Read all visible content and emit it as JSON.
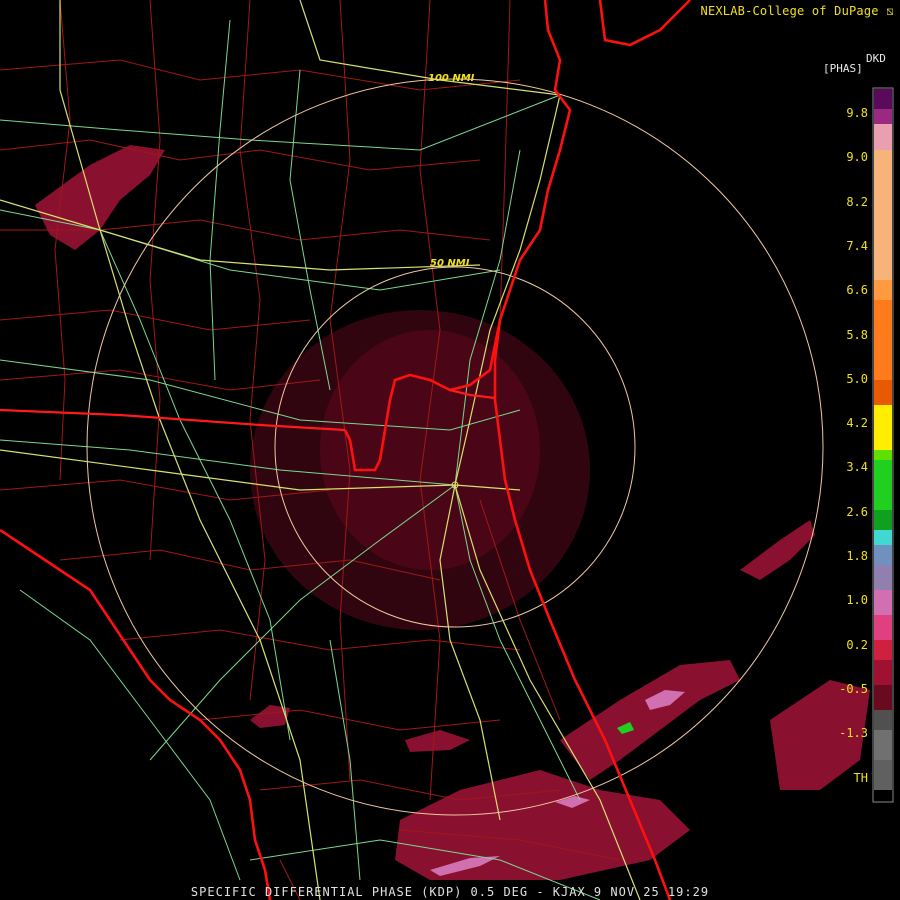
{
  "credit": "NEXLAB-College of DuPage",
  "credit_mark": "⧅",
  "product": {
    "code": "DKD",
    "unit": "[PHAS]",
    "caption": "SPECIFIC DIFFERENTIAL PHASE (KDP) 0.5 DEG - KJAX 9 NOV 25 19:29"
  },
  "range_rings": [
    {
      "label": "100 NMI"
    },
    {
      "label": "50 NMI"
    }
  ],
  "legend": {
    "ticks": [
      "9.8",
      "9.0",
      "8.2",
      "7.4",
      "6.6",
      "5.8",
      "5.0",
      "4.2",
      "3.4",
      "2.6",
      "1.8",
      "1.0",
      "0.2",
      "-0.5",
      "-1.3",
      "TH"
    ],
    "colors": {
      "magenta_top": "#5a0a5a",
      "purple": "#9a2a80",
      "pink_light": "#e8a0b0",
      "peach": "#f7b47a",
      "orange": "#ff7a1a",
      "orange_dark": "#e85a00",
      "yellow": "#ffee00",
      "green": "#20d020",
      "cyan": "#40d8d0",
      "blue_grey": "#7090c0",
      "pink": "#d070b0",
      "red": "#d02040",
      "maroon": "#6a0a20",
      "grey": "#505050"
    }
  },
  "map_colors": {
    "coast": "#ff1010",
    "state_line": "#ff1a1a",
    "county": "#a01818",
    "highway": "#d8e070",
    "road": "#7ad890",
    "ring": "#f0c8a0",
    "echo_light": "#5a0a1c",
    "echo_mid": "#8a1030",
    "echo_high": "#c02050"
  }
}
